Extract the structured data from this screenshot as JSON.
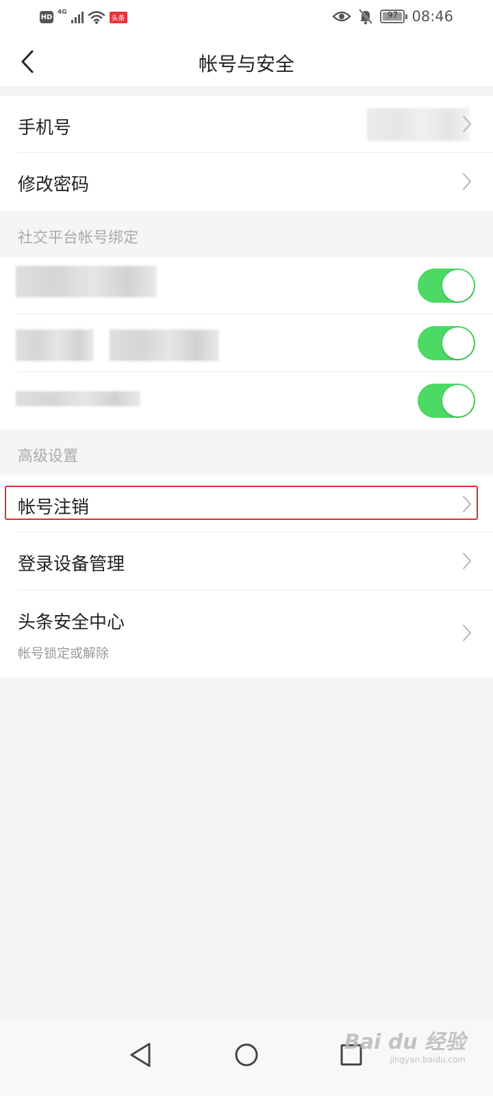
{
  "status_bar": {
    "hd": "HD",
    "network": "4G",
    "app_badge": "头条",
    "battery_level": "97",
    "battery_fraction": 0.97,
    "time": "08:46"
  },
  "nav": {
    "title": "帐号与安全"
  },
  "account": {
    "phone_label": "手机号",
    "password_label": "修改密码"
  },
  "social": {
    "header": "社交平台帐号绑定",
    "bindings": [
      {
        "enabled": true
      },
      {
        "enabled": true
      },
      {
        "enabled": true
      }
    ]
  },
  "advanced": {
    "header": "高级设置",
    "items": [
      {
        "label": "帐号注销"
      },
      {
        "label": "登录设备管理"
      },
      {
        "label": "头条安全中心",
        "sublabel": "帐号锁定或解除"
      }
    ]
  },
  "watermark": {
    "main": "Bai du 经验",
    "sub": "jingyan.baidu.com"
  },
  "colors": {
    "toggle_on": "#4cd964",
    "highlight": "#d32f2f",
    "app_badge": "#e5343d"
  }
}
